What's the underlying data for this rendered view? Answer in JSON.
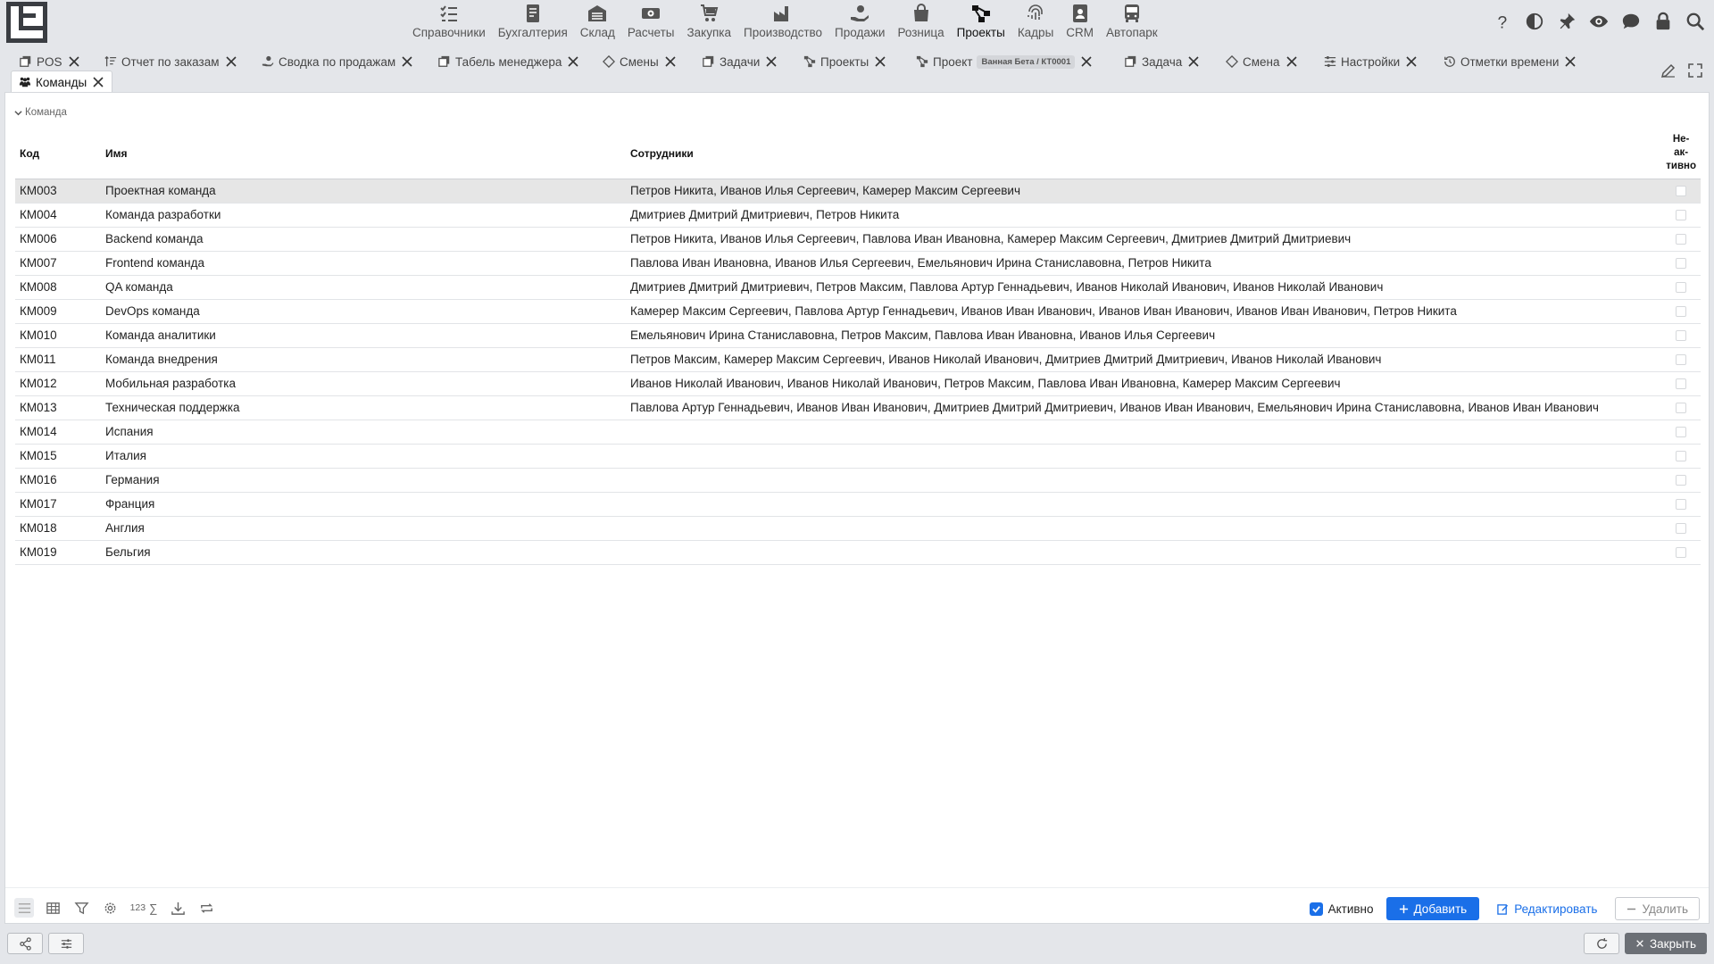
{
  "nav": {
    "items": [
      {
        "label": "Справочники",
        "icon": "list-check-icon"
      },
      {
        "label": "Бухгалтерия",
        "icon": "ledger-icon"
      },
      {
        "label": "Склад",
        "icon": "warehouse-icon"
      },
      {
        "label": "Расчеты",
        "icon": "money-icon"
      },
      {
        "label": "Закупка",
        "icon": "cart-icon"
      },
      {
        "label": "Производство",
        "icon": "factory-icon"
      },
      {
        "label": "Продажи",
        "icon": "hand-money-icon"
      },
      {
        "label": "Розница",
        "icon": "bag-icon"
      },
      {
        "label": "Проекты",
        "icon": "project-tree-icon"
      },
      {
        "label": "Кадры",
        "icon": "fingerprint-icon"
      },
      {
        "label": "CRM",
        "icon": "contact-card-icon"
      },
      {
        "label": "Автопарк",
        "icon": "bus-icon"
      }
    ],
    "active": "Проекты"
  },
  "tabs": [
    {
      "label": "POS"
    },
    {
      "label": "Отчет по заказам"
    },
    {
      "label": "Сводка по продажам"
    },
    {
      "label": "Табель менеджера"
    },
    {
      "label": "Смены"
    },
    {
      "label": "Задачи"
    },
    {
      "label": "Проекты"
    },
    {
      "label": "Проект",
      "badge": "Ванная Бета / КТ0001"
    },
    {
      "label": "Задача"
    },
    {
      "label": "Смена"
    },
    {
      "label": "Настройки"
    },
    {
      "label": "Отметки времени"
    },
    {
      "label": "Команды"
    }
  ],
  "group": {
    "label": "Команда"
  },
  "table": {
    "headers": {
      "code": "Код",
      "name": "Имя",
      "members": "Сотрудники",
      "inactive": [
        "Не-",
        "ак-",
        "тивно"
      ]
    },
    "rows": [
      {
        "code": "КМ003",
        "name": "Проектная команда",
        "members": "Петров Никита, Иванов Илья Сергеевич, Камерер Максим Сергеевич"
      },
      {
        "code": "КМ004",
        "name": "Команда разработки",
        "members": "Дмитриев Дмитрий Дмитриевич, Петров Никита"
      },
      {
        "code": "КМ006",
        "name": "Backend команда",
        "members": "Петров Никита, Иванов Илья Сергеевич, Павлова Иван Ивановна, Камерер Максим Сергеевич, Дмитриев Дмитрий Дмитриевич"
      },
      {
        "code": "КМ007",
        "name": "Frontend команда",
        "members": "Павлова Иван Ивановна, Иванов Илья Сергеевич, Емельянович Ирина Станиславовна, Петров Никита"
      },
      {
        "code": "КМ008",
        "name": "QA команда",
        "members": "Дмитриев Дмитрий Дмитриевич, Петров Максим, Павлова Артур Геннадьевич, Иванов Николай Иванович, Иванов Николай Иванович"
      },
      {
        "code": "КМ009",
        "name": "DevOps команда",
        "members": "Камерер Максим Сергеевич, Павлова Артур Геннадьевич, Иванов Иван Иванович, Иванов Иван Иванович, Иванов Иван Иванович, Петров Никита"
      },
      {
        "code": "КМ010",
        "name": "Команда аналитики",
        "members": "Емельянович Ирина Станиславовна, Петров Максим, Павлова Иван Ивановна, Иванов Илья Сергеевич"
      },
      {
        "code": "КМ011",
        "name": "Команда внедрения",
        "members": "Петров Максим, Камерер Максим Сергеевич, Иванов Николай Иванович, Дмитриев Дмитрий Дмитриевич, Иванов Николай Иванович"
      },
      {
        "code": "КМ012",
        "name": "Мобильная разработка",
        "members": "Иванов Николай Иванович, Иванов Николай Иванович, Петров Максим, Павлова Иван Ивановна, Камерер Максим Сергеевич"
      },
      {
        "code": "КМ013",
        "name": "Техническая поддержка",
        "members": "Павлова Артур Геннадьевич, Иванов Иван Иванович, Дмитриев Дмитрий Дмитриевич, Иванов Иван Иванович, Емельянович Ирина Станиславовна, Иванов Иван Иванович"
      },
      {
        "code": "КМ014",
        "name": "Испания",
        "members": ""
      },
      {
        "code": "КМ015",
        "name": "Италия",
        "members": ""
      },
      {
        "code": "КМ016",
        "name": "Германия",
        "members": ""
      },
      {
        "code": "КМ017",
        "name": "Франция",
        "members": ""
      },
      {
        "code": "КМ018",
        "name": "Англия",
        "members": ""
      },
      {
        "code": "КМ019",
        "name": "Бельгия",
        "members": ""
      }
    ],
    "selected_row": 0
  },
  "toolbar": {
    "count_label": "123",
    "sum_label": "∑",
    "active_label": "Активно",
    "active_checked": true,
    "add_label": "Добавить",
    "edit_label": "Редактировать",
    "delete_label": "Удалить"
  },
  "footer": {
    "close_label": "Закрыть"
  },
  "colors": {
    "accent": "#1a6fe8",
    "background": "#e4e6ea",
    "selected_row": "#e6e6e6"
  }
}
